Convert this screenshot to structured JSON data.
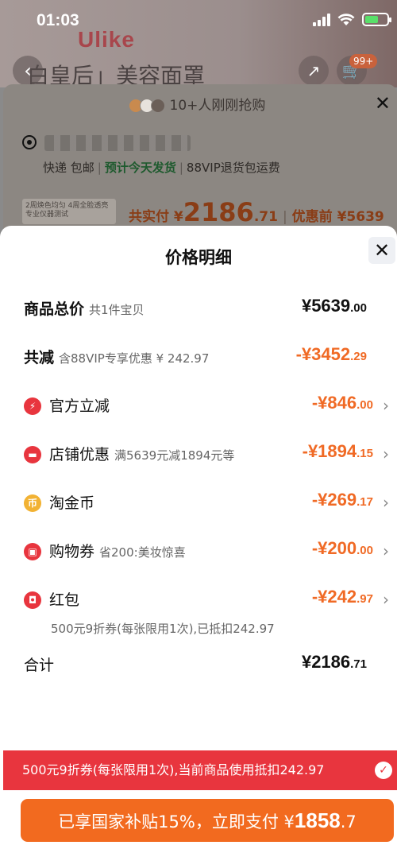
{
  "status_bar": {
    "time": "01:03"
  },
  "background": {
    "brand": "Ulike",
    "title": "白皇后」美容面罩",
    "cart_badge": "99+",
    "grab_text": "10+人刚刚抢购",
    "shipping": [
      "快递 包邮",
      "预计今天发货",
      "88VIP退货包运费"
    ],
    "paid_label": "共实付 ¥",
    "paid_int": "2186",
    "paid_dec": ".71",
    "before_label": "优惠前 ¥5639",
    "promo_thumb": "2周焕色均匀 4周全脸透亮 专业仪器测试"
  },
  "sheet": {
    "title": "价格明细",
    "rows": [
      {
        "label": "商品总价",
        "sub": "共1件宝贝",
        "int": "¥5639",
        "dec": ".00"
      },
      {
        "label": "共减",
        "sub": "含88VIP专享优惠 ¥ 242.97",
        "int": "-¥3452",
        "dec": ".29"
      },
      {
        "label": "官方立减",
        "sub": "",
        "int": "-¥846",
        "dec": ".00"
      },
      {
        "label": "店铺优惠",
        "sub": "满5639元减1894元等",
        "int": "-¥1894",
        "dec": ".15"
      },
      {
        "label": "淘金币",
        "sub": "",
        "int": "-¥269",
        "dec": ".17"
      },
      {
        "label": "购物券",
        "sub": "省200:美妆惊喜",
        "int": "-¥200",
        "dec": ".00"
      },
      {
        "label": "红包",
        "sub": "",
        "int": "-¥242",
        "dec": ".97"
      },
      {
        "label": "合计",
        "sub": "",
        "int": "¥2186",
        "dec": ".71"
      }
    ],
    "redpacket_note": "500元9折券(每张限用1次),已抵扣242.97",
    "notice": "500元9折券(每张限用1次),当前商品使用抵扣242.97",
    "pay_text": "已享国家补贴15%，立即支付 ¥",
    "pay_int": "1858",
    "pay_dec": ".7"
  },
  "colors": {
    "accent_orange": "#f06a25",
    "notice_red": "#e8353e",
    "pay_button": "#f26a1f"
  },
  "icons": [
    "lightning-icon",
    "shop-icon",
    "coin-icon",
    "ticket-icon",
    "redpacket-icon",
    "close-icon",
    "check-icon",
    "chevron-right-icon"
  ]
}
